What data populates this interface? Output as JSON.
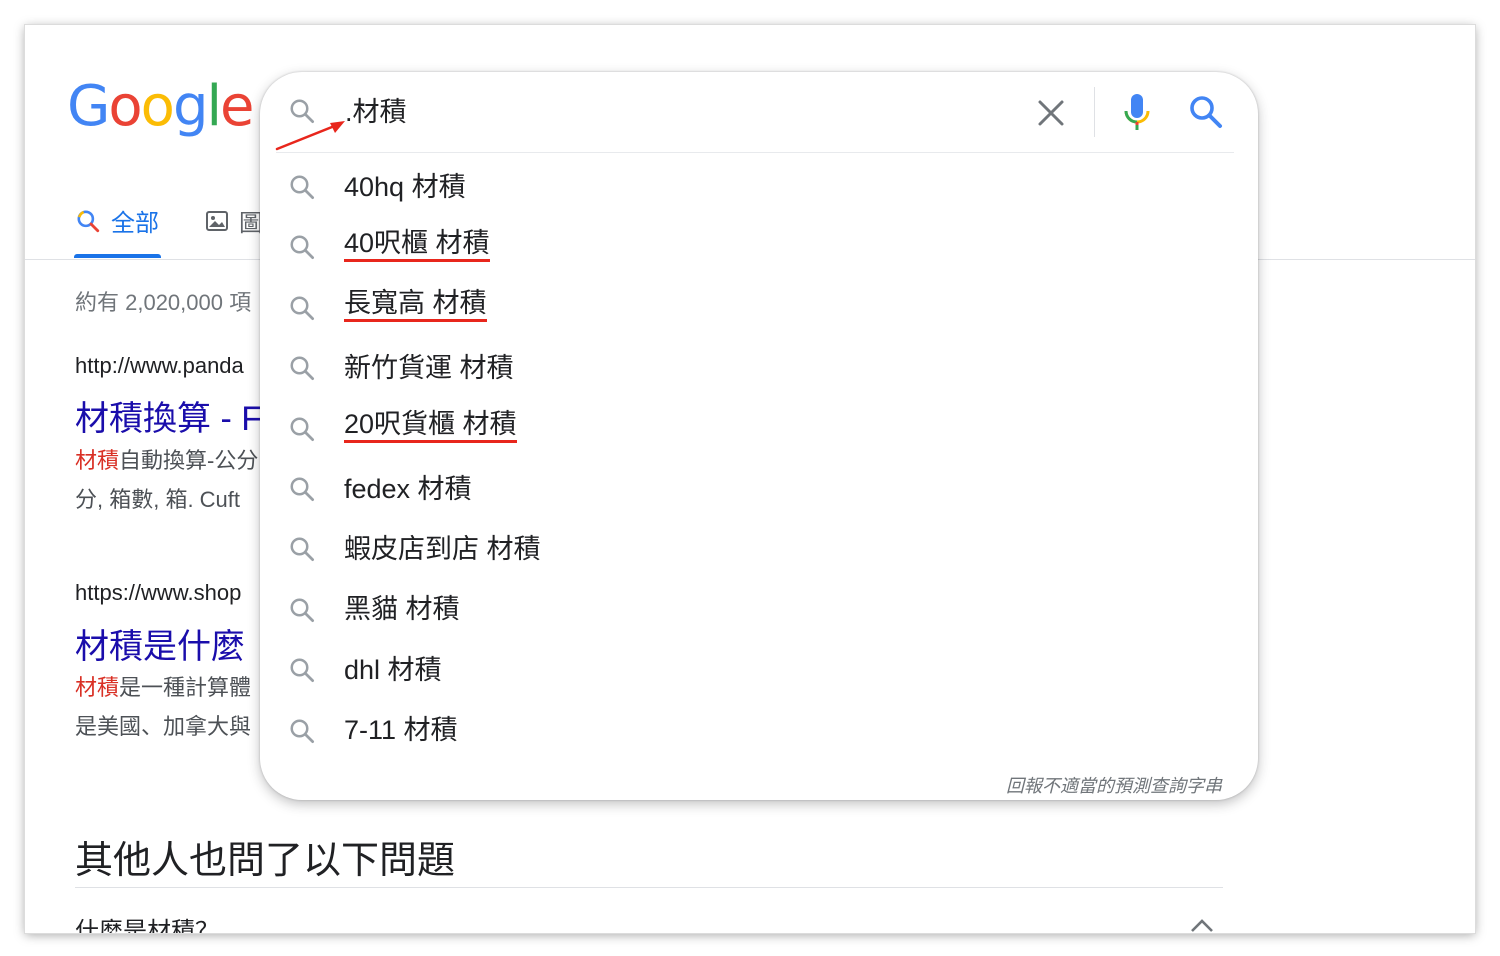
{
  "logo": {
    "letters": [
      "G",
      "o",
      "o",
      "g",
      "l",
      "e"
    ],
    "colors": [
      "#4285f4",
      "#ea4335",
      "#fbbc05",
      "#4285f4",
      "#34a853",
      "#ea4335"
    ]
  },
  "tabs": [
    {
      "label": "全部",
      "icon": "search-icon",
      "active": true
    },
    {
      "label": "圖",
      "icon": "image-icon",
      "active": false
    }
  ],
  "result_stats": "約有 2,020,000 項",
  "results": [
    {
      "cite": "http://www.panda",
      "title": "材積換算 - F",
      "snippet_line1_highlight": "材積",
      "snippet_line1_rest": "自動換算-公分",
      "snippet_line2": "分, 箱數, 箱. Cuft"
    },
    {
      "cite": "https://www.shop",
      "title": "材積是什麼",
      "snippet_line1_highlight": "材積",
      "snippet_line1_rest": "是一種計算體",
      "snippet_line2": "是美國、加拿大與"
    }
  ],
  "people_also_ask": {
    "heading": "其他人也問了以下問題",
    "first_question": "什麼是材積？"
  },
  "search": {
    "query": ".材積",
    "suggestions": [
      {
        "text": "40hq 材積",
        "underlined": false
      },
      {
        "text": "40呎櫃 材積",
        "underlined": true
      },
      {
        "text": "長寬高 材積",
        "underlined": true
      },
      {
        "text": "新竹貨運 材積",
        "underlined": false
      },
      {
        "text": "20呎貨櫃 材積",
        "underlined": true
      },
      {
        "text": "fedex 材積",
        "underlined": false
      },
      {
        "text": "蝦皮店到店 材積",
        "underlined": false
      },
      {
        "text": "黑貓 材積",
        "underlined": false
      },
      {
        "text": "dhl 材積",
        "underlined": false
      },
      {
        "text": "7-11 材積",
        "underlined": false
      }
    ],
    "report_link": "回報不適當的預測查詢字串"
  },
  "colors": {
    "accent": "#1a73e8",
    "link": "#1a0dab",
    "highlight": "#d93025",
    "annotation": "#e8261c"
  }
}
